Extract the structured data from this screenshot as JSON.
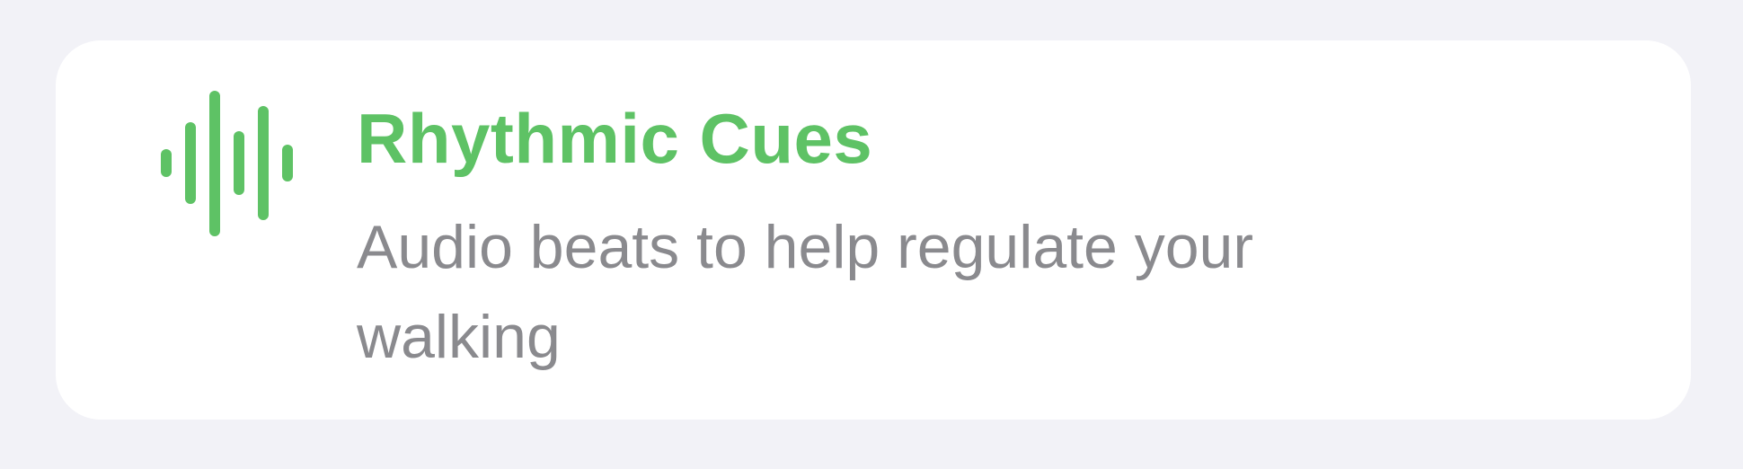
{
  "card": {
    "icon": "waveform-icon",
    "title": "Rhythmic Cues",
    "description": "Audio beats to help regulate your walking"
  },
  "colors": {
    "accent": "#5ec265",
    "background": "#f2f2f7",
    "card": "#ffffff",
    "secondary_text": "#8a8a8e"
  }
}
